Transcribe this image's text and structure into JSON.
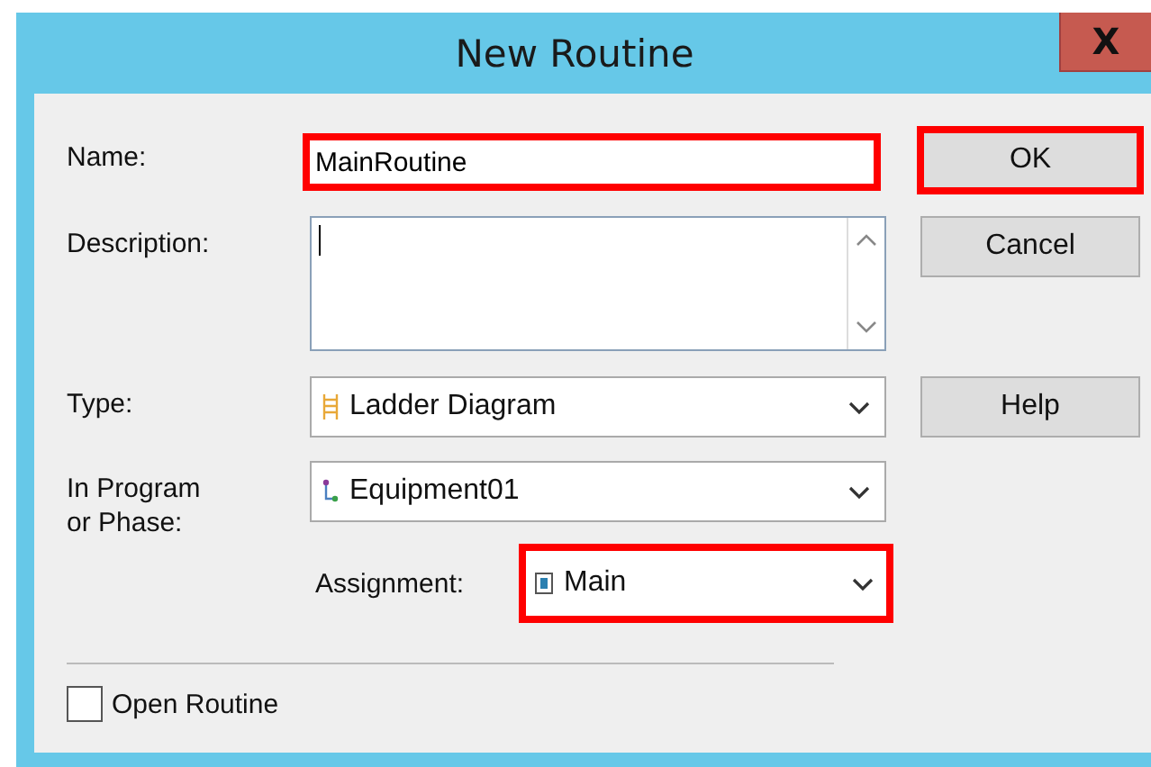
{
  "window": {
    "title": "New Routine",
    "close": "X"
  },
  "name": {
    "label": "Name:",
    "value": "MainRoutine",
    "highlighted": true
  },
  "description": {
    "label": "Description:",
    "focused": true
  },
  "type": {
    "label": "Type:",
    "value": "Ladder Diagram",
    "highlighted": false
  },
  "program": {
    "label": "In Program or Phase:",
    "value": "Equipment01",
    "highlighted": false
  },
  "assignment": {
    "label": "Assignment:",
    "value": "Main",
    "highlighted": true
  },
  "buttons": [
    {
      "label": "OK",
      "highlighted": true
    },
    {
      "label": "Cancel",
      "highlighted": false
    },
    {
      "label": "Help",
      "highlighted": false
    }
  ],
  "open_routine": {
    "label": "Open Routine",
    "checked": false
  }
}
